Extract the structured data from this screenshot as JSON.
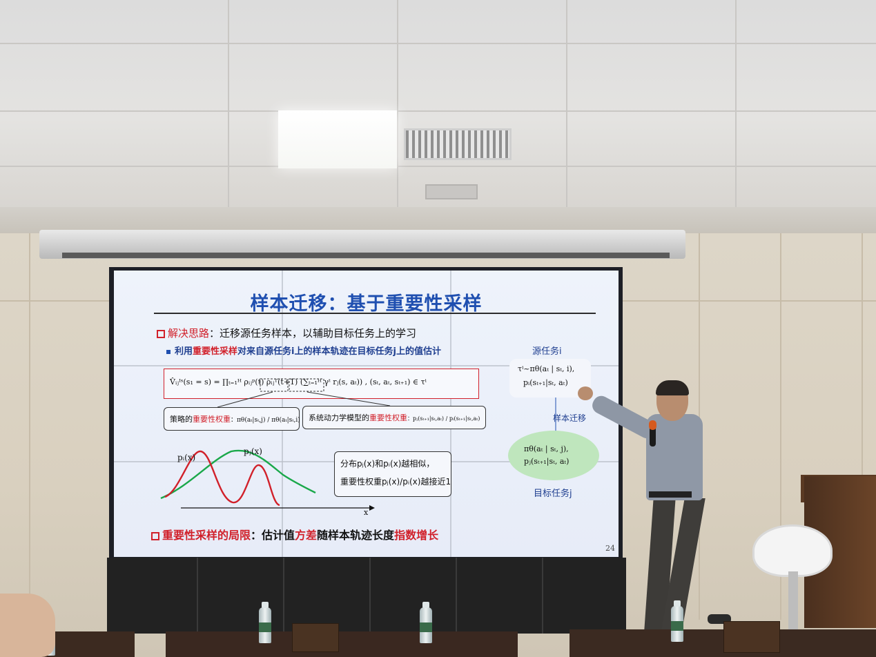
{
  "slide": {
    "title": "样本迁移：基于重要性采样",
    "bullet1_prefix": "解决思路",
    "bullet1_text": "：迁移源任务样本，以辅助目标任务上的学习",
    "sub_bullet_a": "利用",
    "sub_bullet_b": "重要性采样",
    "sub_bullet_c": "对来自源任务i上的样本轨迹在目标任务j上的值估计",
    "source_task_label": "源任务i",
    "main_formula": "V̂ᵢⱼᴵˢ(s₁ = s) = ∏ₜ₌₁ᴴ ρᵢⱼᵖ(t) ρᵢⱼᵀ(t+1) (∑ₜ₌₁ᴴ γᵗ rⱼ(s, aₜ)) , (sₜ, aₜ, sₜ₊₁) ∈ τⁱ",
    "box_policy_a": "策略的",
    "box_policy_b": "重要性权重",
    "box_policy_c": "：πθ(aₜ|sₜ,j) / πθ(aₜ|sₜ,i)",
    "box_dyn_a": "系统动力学模型的",
    "box_dyn_b": "重要性权重",
    "box_dyn_c": "：pⱼ(sₜ₊₁|sₜ,aₜ) / pᵢ(sₜ₊₁|sₜ,aₜ)",
    "source_formula_1": "τⁱ~πθ(aₜ | sₜ, i),",
    "source_formula_2": "pᵢ(sₜ₊₁|sₜ, aₜ)",
    "arrow_label": "样本迁移",
    "target_formula_1": "πθ(aₜ | sₜ, j),",
    "target_formula_2": "pⱼ(sₜ₊₁|sₜ, aₜ)",
    "target_task_label": "目标任务j",
    "curve_label_i": "pᵢ(x)",
    "curve_label_j": "pⱼ(x)",
    "axis_label_x": "x",
    "note_line1": "分布pⱼ(x)和pᵢ(x)越相似，",
    "note_line2": "重要性权重pⱼ(x)/pᵢ(x)越接近1",
    "bottom_a": "重要性采样的局限",
    "bottom_b": "：估计值",
    "bottom_c": "方差",
    "bottom_d": "随样本轨迹长度",
    "bottom_e": "指数增长",
    "page_number": "24"
  },
  "colors": {
    "title_blue": "#1f4fb0",
    "accent_red": "#d1202a",
    "curve_green": "#1aa84a",
    "target_ellipse": "#bfe6bd"
  }
}
